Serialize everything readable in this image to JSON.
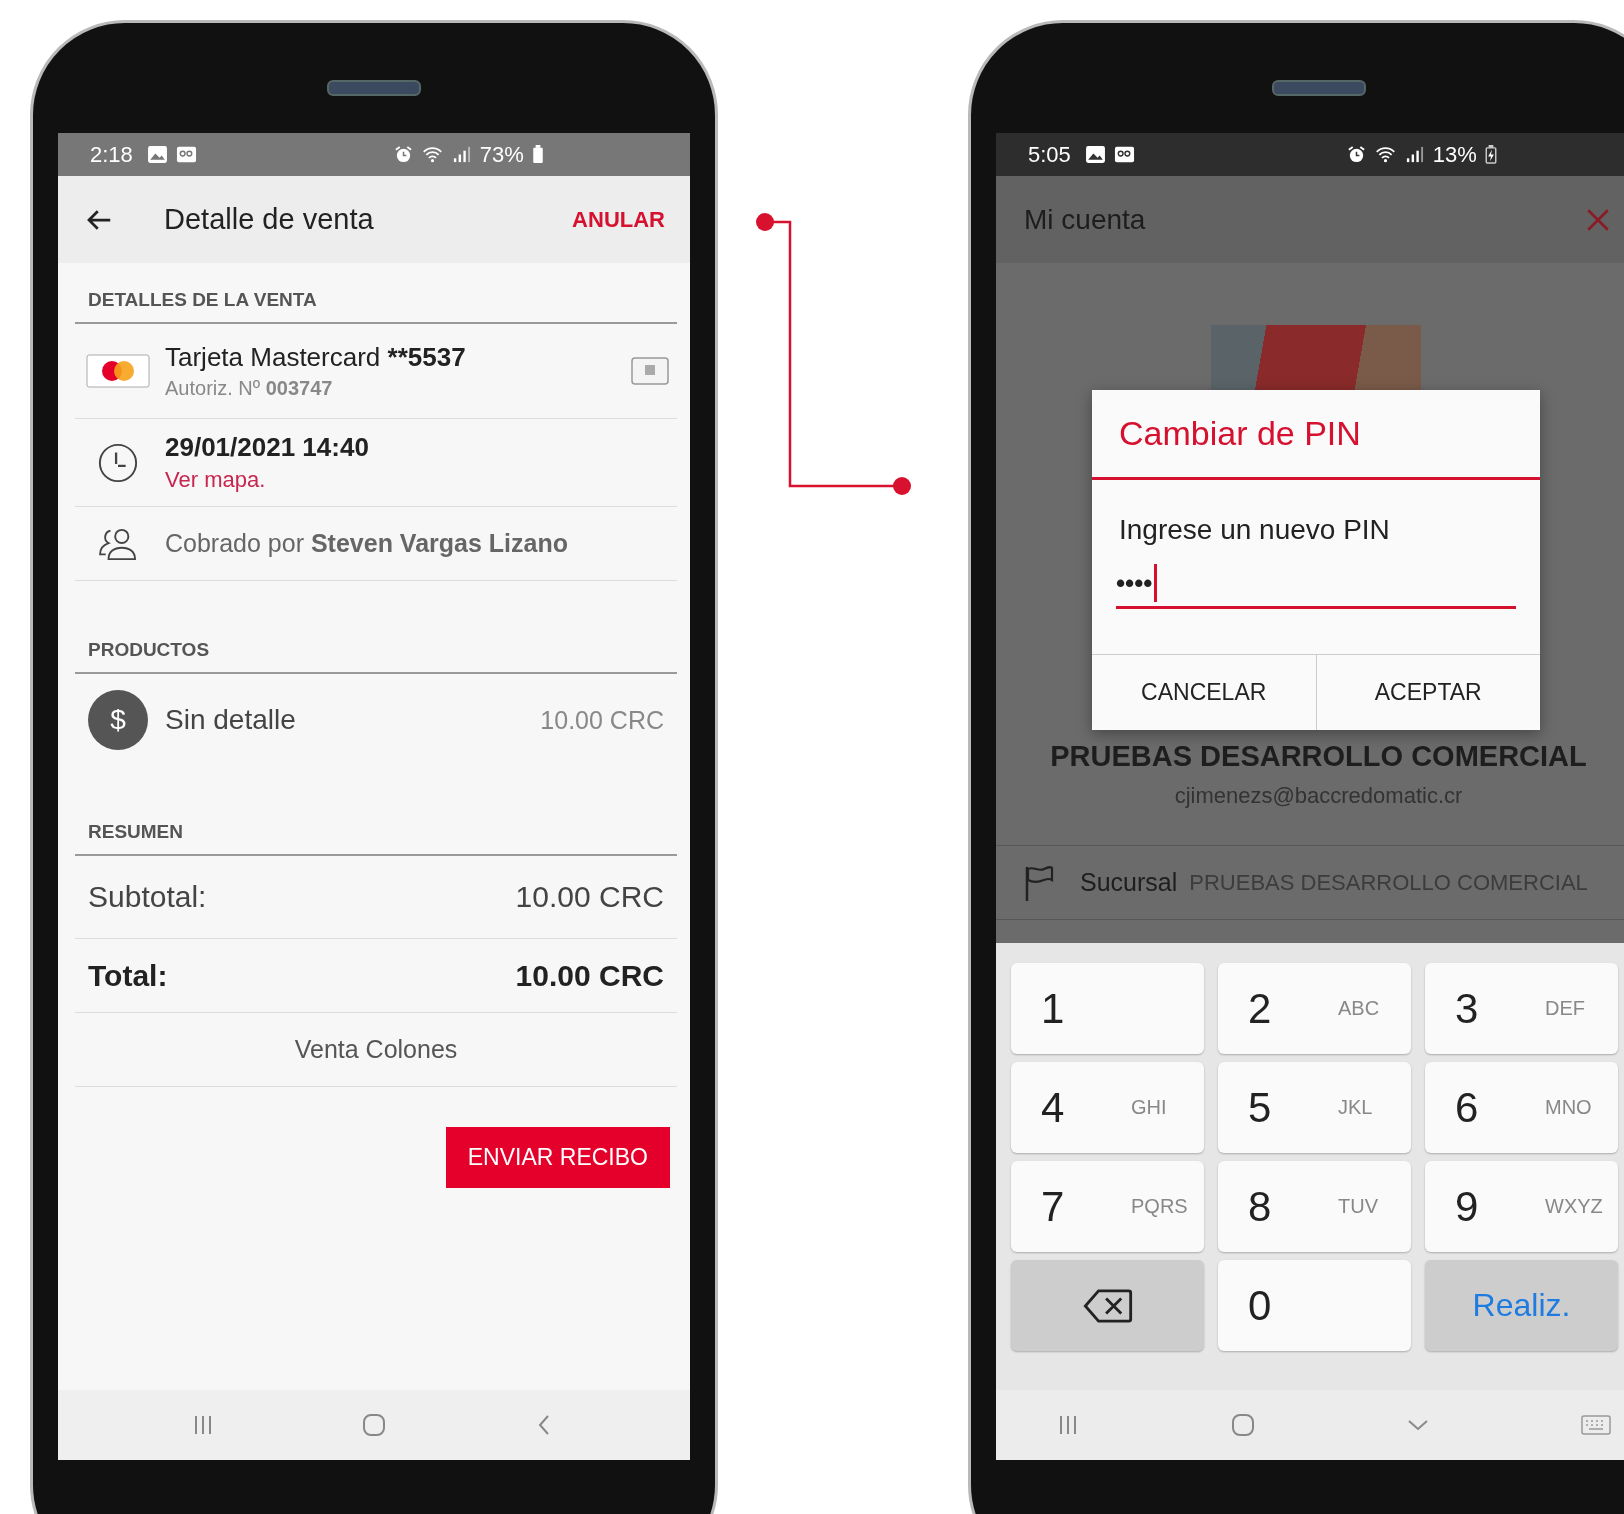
{
  "left_phone": {
    "status_bar": {
      "time": "2:18",
      "battery": "73%"
    },
    "app_bar": {
      "title": "Detalle de venta",
      "action": "ANULAR"
    },
    "sale_details": {
      "heading": "DETALLES DE LA VENTA",
      "card_name": "Tarjeta Mastercard",
      "card_number": "**5537",
      "authorization": "Autoriz. Nº **003747**",
      "date": "29/01/2021 14:40",
      "map_link": "Ver mapa.",
      "collector": "Cobrado por **Steven Vargas Lizano**"
    },
    "products": {
      "heading": "PRODUCTOS",
      "items": [
        {
          "name": "Sin detalle",
          "amount": "10.00 CRC",
          "icon": "$"
        }
      ]
    },
    "summary": {
      "heading": "RESUMEN",
      "subtotal_label": "Subtotal:",
      "subtotal": "10.00 CRC",
      "total_label": "Total:",
      "total": "10.00 CRC",
      "note": "Venta Colones"
    },
    "button": "ENVIAR RECIBO"
  },
  "right_phone": {
    "status_bar": {
      "time": "5:05",
      "battery": "13%"
    },
    "app_bar": {
      "title": "Mi cuenta"
    },
    "account": {
      "name": "PRUEBAS DESARROLLO COMERCIAL",
      "email": "cjimenezs@baccredomatic.cr"
    },
    "branch": {
      "label": "Sucursal",
      "value": "PRUEBAS DESARROLLO COMERCIAL"
    },
    "dialog": {
      "title": "Cambiar de PIN",
      "label": "Ingrese un nuevo PIN",
      "value": "••••",
      "buttons": [
        "CANCELAR",
        "ACEPTAR"
      ]
    },
    "keypad": [
      {
        "kind": "digit",
        "digit": "1"
      },
      {
        "kind": "digit",
        "digit": "2",
        "letters": "ABC"
      },
      {
        "kind": "digit",
        "digit": "3",
        "letters": "DEF"
      },
      {
        "kind": "digit",
        "digit": "4",
        "letters": "GHI"
      },
      {
        "kind": "digit",
        "digit": "5",
        "letters": "JKL"
      },
      {
        "kind": "digit",
        "digit": "6",
        "letters": "MNO"
      },
      {
        "kind": "digit",
        "digit": "7",
        "letters": "PQRS"
      },
      {
        "kind": "digit",
        "digit": "8",
        "letters": "TUV"
      },
      {
        "kind": "digit",
        "digit": "9",
        "letters": "WXYZ"
      },
      {
        "kind": "backspace"
      },
      {
        "kind": "digit",
        "digit": "0"
      },
      {
        "kind": "done",
        "label": "Realiz."
      }
    ]
  }
}
